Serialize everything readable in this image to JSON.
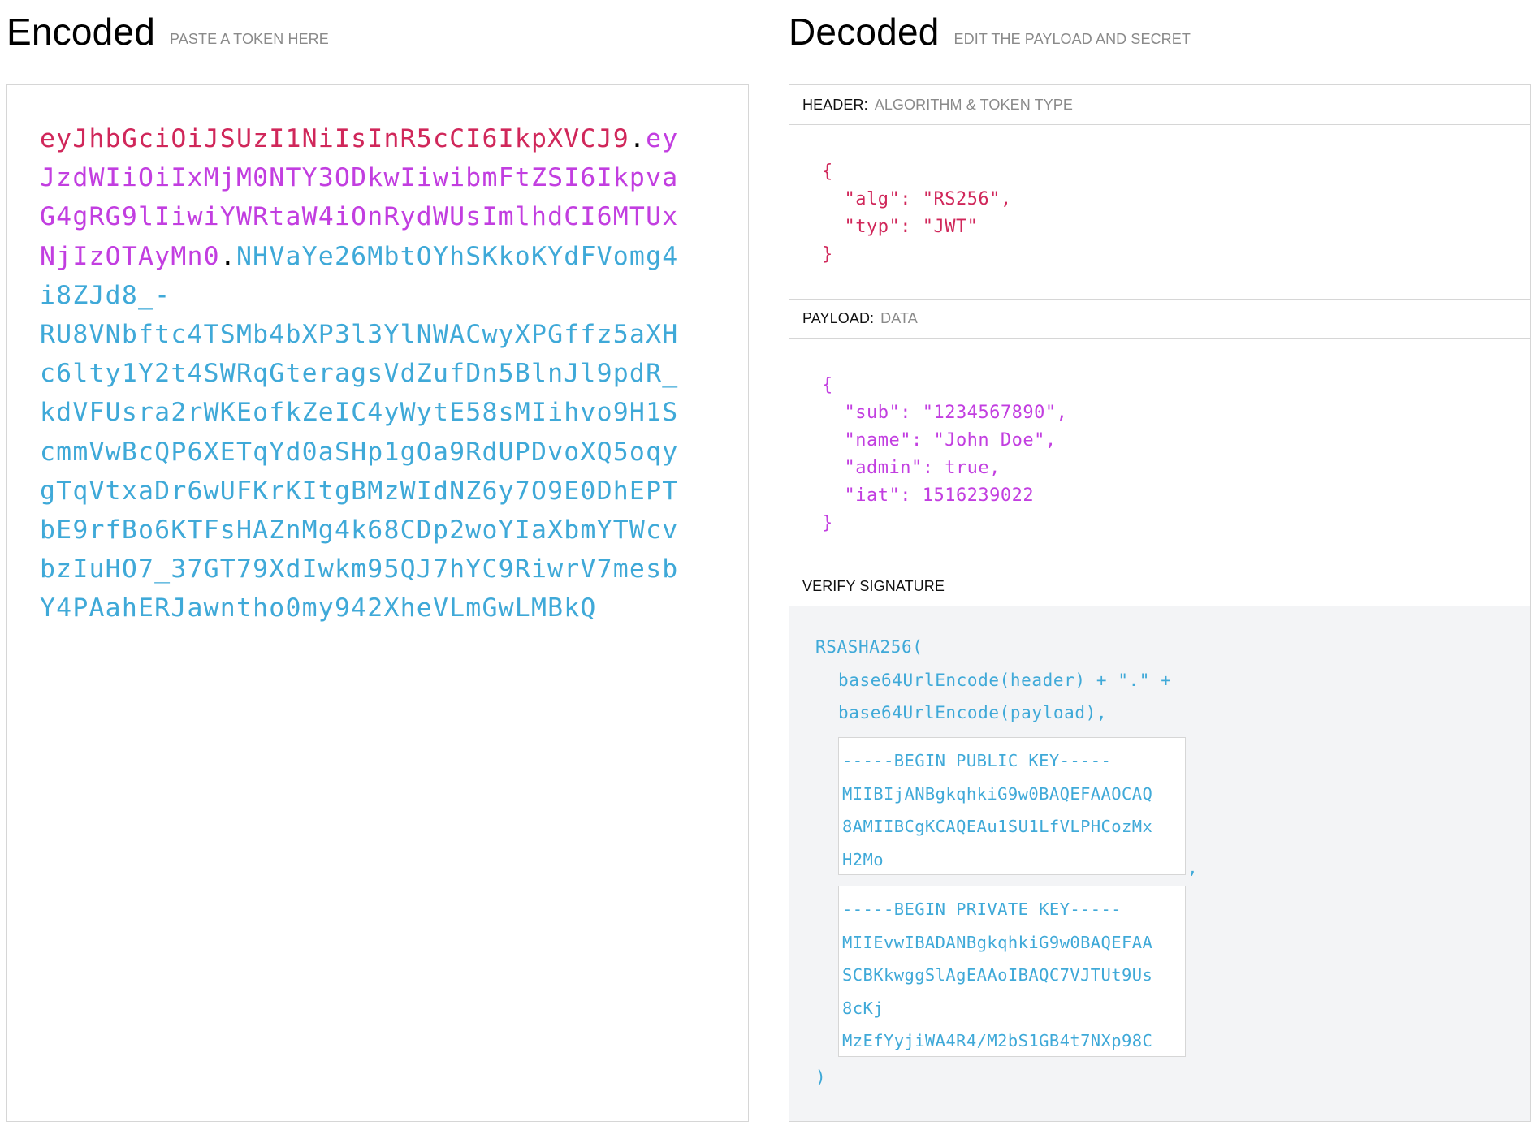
{
  "encoded": {
    "title": "Encoded",
    "subtitle": "PASTE A TOKEN HERE",
    "token_lines": [
      [
        {
          "t": "eyJhbGciOiJSUzI1NiIsInR5cCI6IkpXVCJ9",
          "c": "hdr"
        },
        {
          "t": ".",
          "c": "dot"
        },
        {
          "t": "ey",
          "c": "pay"
        }
      ],
      [
        {
          "t": "JzdWIiOiIxMjM0NTY3ODkwIiwibmFtZSI6Ikpva",
          "c": "pay"
        }
      ],
      [
        {
          "t": "G4gRG9lIiwiYWRtaW4iOnRydWUsImlhdCI6MTUx",
          "c": "pay"
        }
      ],
      [
        {
          "t": "NjIzOTAyMn0",
          "c": "pay"
        },
        {
          "t": ".",
          "c": "dot"
        },
        {
          "t": "NHVaYe26MbtOYhSKkoKYdFVomg4",
          "c": "sig"
        }
      ],
      [
        {
          "t": "i8ZJd8_-",
          "c": "sig"
        }
      ],
      [
        {
          "t": "RU8VNbftc4TSMb4bXP3l3YlNWACwyXPGffz5aXH",
          "c": "sig"
        }
      ],
      [
        {
          "t": "c6lty1Y2t4SWRqGteragsVdZufDn5BlnJl9pdR_",
          "c": "sig"
        }
      ],
      [
        {
          "t": "kdVFUsra2rWKEofkZeIC4yWytE58sMIihvo9H1S",
          "c": "sig"
        }
      ],
      [
        {
          "t": "cmmVwBcQP6XETqYd0aSHp1gOa9RdUPDvoXQ5oqy",
          "c": "sig"
        }
      ],
      [
        {
          "t": "gTqVtxaDr6wUFKrKItgBMzWIdNZ6y7O9E0DhEPT",
          "c": "sig"
        }
      ],
      [
        {
          "t": "bE9rfBo6KTFsHAZnMg4k68CDp2woYIaXbmYTWcv",
          "c": "sig"
        }
      ],
      [
        {
          "t": "bzIuHO7_37GT79XdIwkm95QJ7hYC9RiwrV7mesb",
          "c": "sig"
        }
      ],
      [
        {
          "t": "Y4PAahERJawntho0my942XheVLmGwLMBkQ",
          "c": "sig"
        }
      ]
    ]
  },
  "decoded": {
    "title": "Decoded",
    "subtitle": "EDIT THE PAYLOAD AND SECRET",
    "header_section": {
      "label": "HEADER:",
      "sub": "ALGORITHM & TOKEN TYPE",
      "json_text": "{\n  \"alg\": \"RS256\",\n  \"typ\": \"JWT\"\n}"
    },
    "payload_section": {
      "label": "PAYLOAD:",
      "sub": "DATA",
      "json_text": "{\n  \"sub\": \"1234567890\",\n  \"name\": \"John Doe\",\n  \"admin\": true,\n  \"iat\": 1516239022\n}"
    },
    "verify_section": {
      "label": "VERIFY SIGNATURE",
      "fn_open": "RSASHA256(",
      "line_header": "base64UrlEncode(header) + \".\" +",
      "line_payload": "base64UrlEncode(payload),",
      "public_key_text": "-----BEGIN PUBLIC KEY-----\nMIIBIjANBgkqhkiG9w0BAQEFAAOCAQ\n8AMIIBCgKCAQEAu1SU1LfVLPHCozMx\nH2Mo",
      "comma": ",",
      "private_key_text": "-----BEGIN PRIVATE KEY-----\nMIIEvwIBADANBgkqhkiG9w0BAQEFAA\nSCBKkwggSlAgEAAoIBAQC7VJTUt9Us\n8cKj\nMzEfYyjiWA4R4/M2bS1GB4t7NXp98C",
      "fn_close": ")"
    }
  },
  "colors": {
    "header": "#d0275a",
    "payload": "#c23ee0",
    "signature": "#3fa9d8",
    "border": "#d6d6d6",
    "muted": "#8a8a8a",
    "verify_bg": "#f3f4f6"
  }
}
